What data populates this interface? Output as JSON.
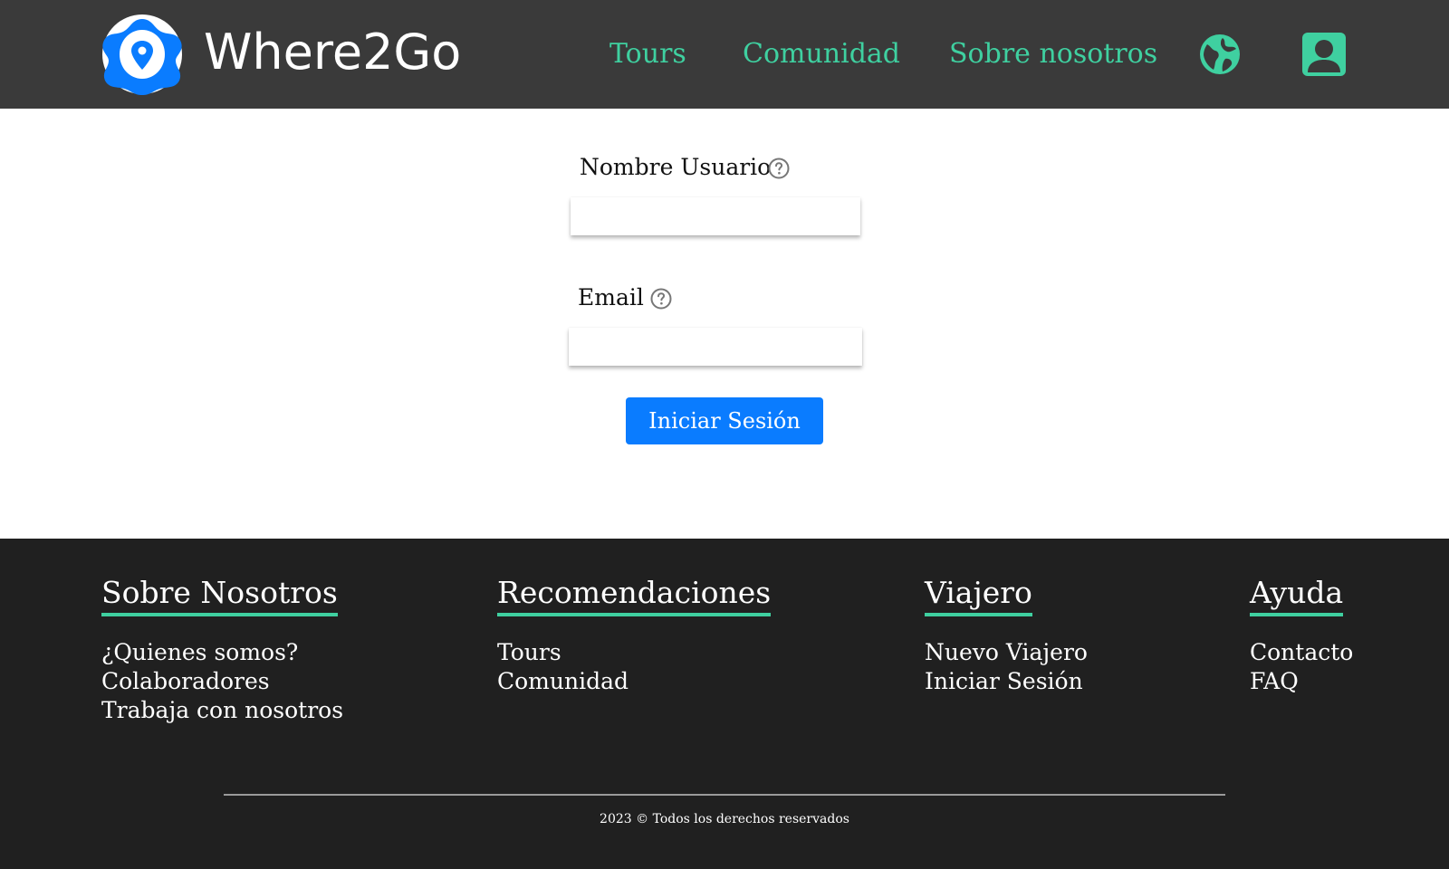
{
  "header": {
    "brand": "Where2Go",
    "nav": {
      "tours": "Tours",
      "community": "Comunidad",
      "about": "Sobre nosotros"
    },
    "icons": [
      "logo-icon",
      "globe-icon",
      "user-account-icon"
    ],
    "accent_color": "#3fd0a0",
    "background_color": "#3a3a3a"
  },
  "form": {
    "username_label": "Nombre Usuario",
    "username_value": "",
    "email_label": "Email",
    "email_value": "",
    "submit_label": "Iniciar Sesión",
    "button_color": "#0a7cff"
  },
  "footer": {
    "background_color": "#202020",
    "columns": [
      {
        "title": "Sobre Nosotros",
        "links": [
          "¿Quienes somos?",
          "Colaboradores",
          "Trabaja con nosotros"
        ]
      },
      {
        "title": "Recomendaciones",
        "links": [
          "Tours",
          "Comunidad"
        ]
      },
      {
        "title": "Viajero",
        "links": [
          "Nuevo Viajero",
          "Iniciar Sesión"
        ]
      },
      {
        "title": "Ayuda",
        "links": [
          "Contacto",
          "FAQ"
        ]
      }
    ],
    "copyright": "2023 © Todos los derechos reservados"
  }
}
